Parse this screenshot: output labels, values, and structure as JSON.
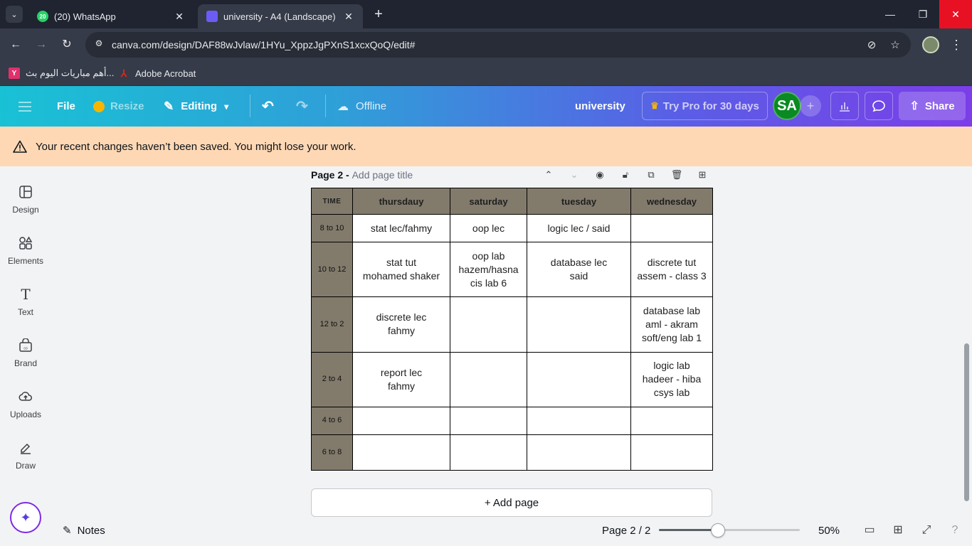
{
  "browser": {
    "tabs": [
      {
        "title": "(20) WhatsApp",
        "badge": "20",
        "active": false
      },
      {
        "title": "university - A4 (Landscape)",
        "active": true
      }
    ],
    "url": "canva.com/design/DAF88wJvlaw/1HYu_XppzJgPXnS1xcxQoQ/edit#",
    "bookmarks": [
      {
        "label": "أهم مباريات اليوم بث...",
        "icon": "Y"
      },
      {
        "label": "Adobe Acrobat"
      }
    ]
  },
  "header": {
    "file_label": "File",
    "resize_label": "Resize",
    "editing_label": "Editing",
    "offline_label": "Offline",
    "design_title": "university",
    "pro_label": "Try Pro for 30 days",
    "avatar_initials": "SA",
    "share_label": "Share"
  },
  "banner": {
    "message": "Your recent changes haven’t been saved. You might lose your work."
  },
  "sidebar": {
    "items": [
      {
        "label": "Design",
        "icon": "design-icon"
      },
      {
        "label": "Elements",
        "icon": "elements-icon"
      },
      {
        "label": "Text",
        "icon": "text-icon"
      },
      {
        "label": "Brand",
        "icon": "brand-icon"
      },
      {
        "label": "Uploads",
        "icon": "uploads-icon"
      },
      {
        "label": "Draw",
        "icon": "draw-icon"
      }
    ]
  },
  "page": {
    "label": "Page 2 -",
    "title_placeholder": "Add page title"
  },
  "timetable": {
    "headers": [
      "TIME",
      "thursdauy",
      "saturday",
      "tuesday",
      "wednesday"
    ],
    "rows": [
      {
        "time": "8 to 10",
        "cells": [
          [
            "stat lec/fahmy"
          ],
          [
            "oop lec"
          ],
          [
            "logic lec / said"
          ],
          []
        ]
      },
      {
        "time": "10 to 12",
        "cells": [
          [
            "stat tut",
            "mohamed shaker"
          ],
          [
            "oop lab",
            "hazem/hasna",
            "cis lab 6"
          ],
          [
            "database lec",
            "said"
          ],
          [
            "discrete tut",
            "assem - class 3"
          ]
        ]
      },
      {
        "time": "12 to 2",
        "cells": [
          [
            "discrete lec",
            "fahmy"
          ],
          [],
          [],
          [
            "database lab",
            "aml - akram",
            "soft/eng lab 1"
          ]
        ]
      },
      {
        "time": "2 to 4",
        "cells": [
          [
            "report lec",
            "fahmy"
          ],
          [],
          [],
          [
            "logic lab",
            "hadeer - hiba",
            "csys lab"
          ]
        ]
      },
      {
        "time": "4 to 6",
        "cells": [
          [],
          [],
          [],
          []
        ]
      },
      {
        "time": "6 to 8",
        "cells": [
          [],
          [],
          [],
          []
        ]
      }
    ]
  },
  "add_page_label": "+ Add page",
  "footer": {
    "notes_label": "Notes",
    "page_count": "Page 2 / 2",
    "zoom_value": "50%",
    "zoom_fraction": 0.42
  },
  "colors": {
    "header_cell": "#827b6c",
    "banner": "#fed8b5",
    "avatar": "#0a8a22"
  }
}
